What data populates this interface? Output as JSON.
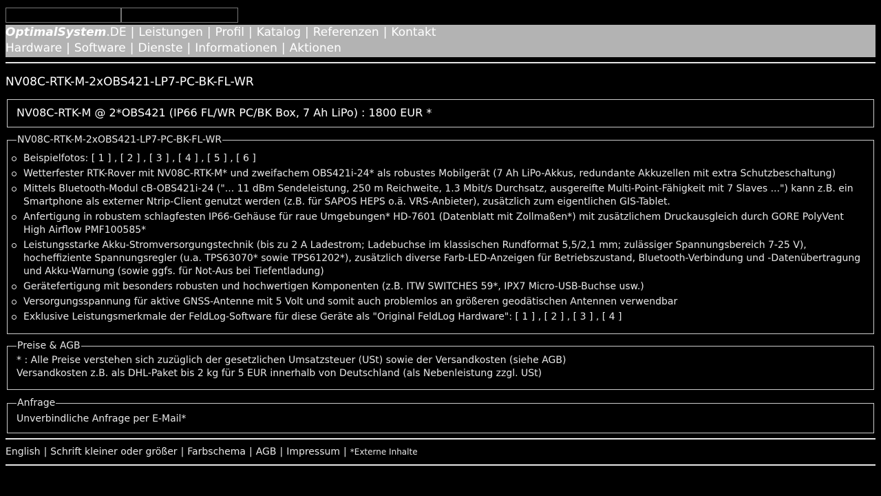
{
  "nav": {
    "row1": [
      {
        "label": "OptimalSystem",
        "suffix": ".DE"
      },
      {
        "label": "Leistungen"
      },
      {
        "label": "Profil"
      },
      {
        "label": "Katalog"
      },
      {
        "label": "Referenzen"
      },
      {
        "label": "Kontakt"
      }
    ],
    "row2": [
      "Hardware",
      "Software",
      "Dienste",
      "Informationen",
      "Aktionen"
    ],
    "separator": "|"
  },
  "page_title": "NV08C-RTK-M-2xOBS421-LP7-PC-BK-FL-WR",
  "price_line": "NV08C-RTK-M @ 2*OBS421 (IP66 FL/WR PC/BK Box, 7 Ah LiPo) : 1800 EUR *",
  "product": {
    "legend": "NV08C-RTK-M-2xOBS421-LP7-PC-BK-FL-WR",
    "items": [
      "Beispielfotos: [ 1 ] , [ 2 ] , [ 3 ] , [ 4 ] , [ 5 ] , [ 6 ]",
      "Wetterfester RTK-Rover mit NV08C-RTK-M* und zweifachem OBS421i-24* als robustes Mobilgerät (7 Ah LiPo-Akkus, redundante Akkuzellen mit extra Schutzbeschaltung)",
      "Mittels Bluetooth-Modul cB-OBS421i-24 (\"... 11 dBm Sendeleistung, 250 m Reichweite, 1.3 Mbit/s Durchsatz, ausgereifte Multi-Point-Fähigkeit mit 7 Slaves ...\") kann z.B. ein Smartphone als externer Ntrip-Client genutzt werden (z.B. für SAPOS HEPS o.ä. VRS-Anbieter), zusätzlich zum eigentlichen GIS-Tablet.",
      "Anfertigung in robustem schlagfesten IP66-Gehäuse für raue Umgebungen* HD-7601 (Datenblatt mit Zollmaßen*) mit zusätzlichem Druckausgleich durch GORE PolyVent High Airflow PMF100585*",
      "Leistungsstarke Akku-Stromversorgungstechnik (bis zu 2 A Ladestrom; Ladebuchse im klassischen Rundformat 5,5/2,1 mm; zulässiger Spannungsbereich 7-25 V), hocheffiziente Spannungsregler (u.a. TPS63070* sowie TPS61202*), zusätzlich diverse Farb-LED-Anzeigen für Betriebszustand, Bluetooth-Verbindung und -Datenübertragung und Akku-Warnung (sowie ggfs. für Not-Aus bei Tiefentladung)",
      "Gerätefertigung mit besonders robusten und hochwertigen Komponenten (z.B. ITW SWITCHES 59*, IPX7 Micro-USB-Buchse usw.)",
      "Versorgungsspannung für aktive GNSS-Antenne mit 5 Volt und somit auch problemlos an größeren geodätischen Antennen verwendbar",
      "Exklusive Leistungsmerkmale der FeldLog-Software für diese Geräte als \"Original FeldLog Hardware\": [ 1 ] , [ 2 ] , [ 3 ] , [ 4 ]"
    ]
  },
  "prices": {
    "legend": "Preise & AGB",
    "line1": "* : Alle Preise verstehen sich zuzüglich der gesetzlichen Umsatzsteuer (USt) sowie der Versandkosten (siehe AGB)",
    "line2": "Versandkosten z.B. als DHL-Paket bis 2 kg für 5 EUR innerhalb von Deutschland (als Nebenleistung zzgl. USt)"
  },
  "anfrage": {
    "legend": "Anfrage",
    "line": "Unverbindliche Anfrage per E-Mail*"
  },
  "footer": {
    "links": [
      "English",
      "Schrift kleiner oder größer",
      "Farbschema",
      "AGB",
      "Impressum"
    ],
    "note": "*Externe Inhalte"
  }
}
